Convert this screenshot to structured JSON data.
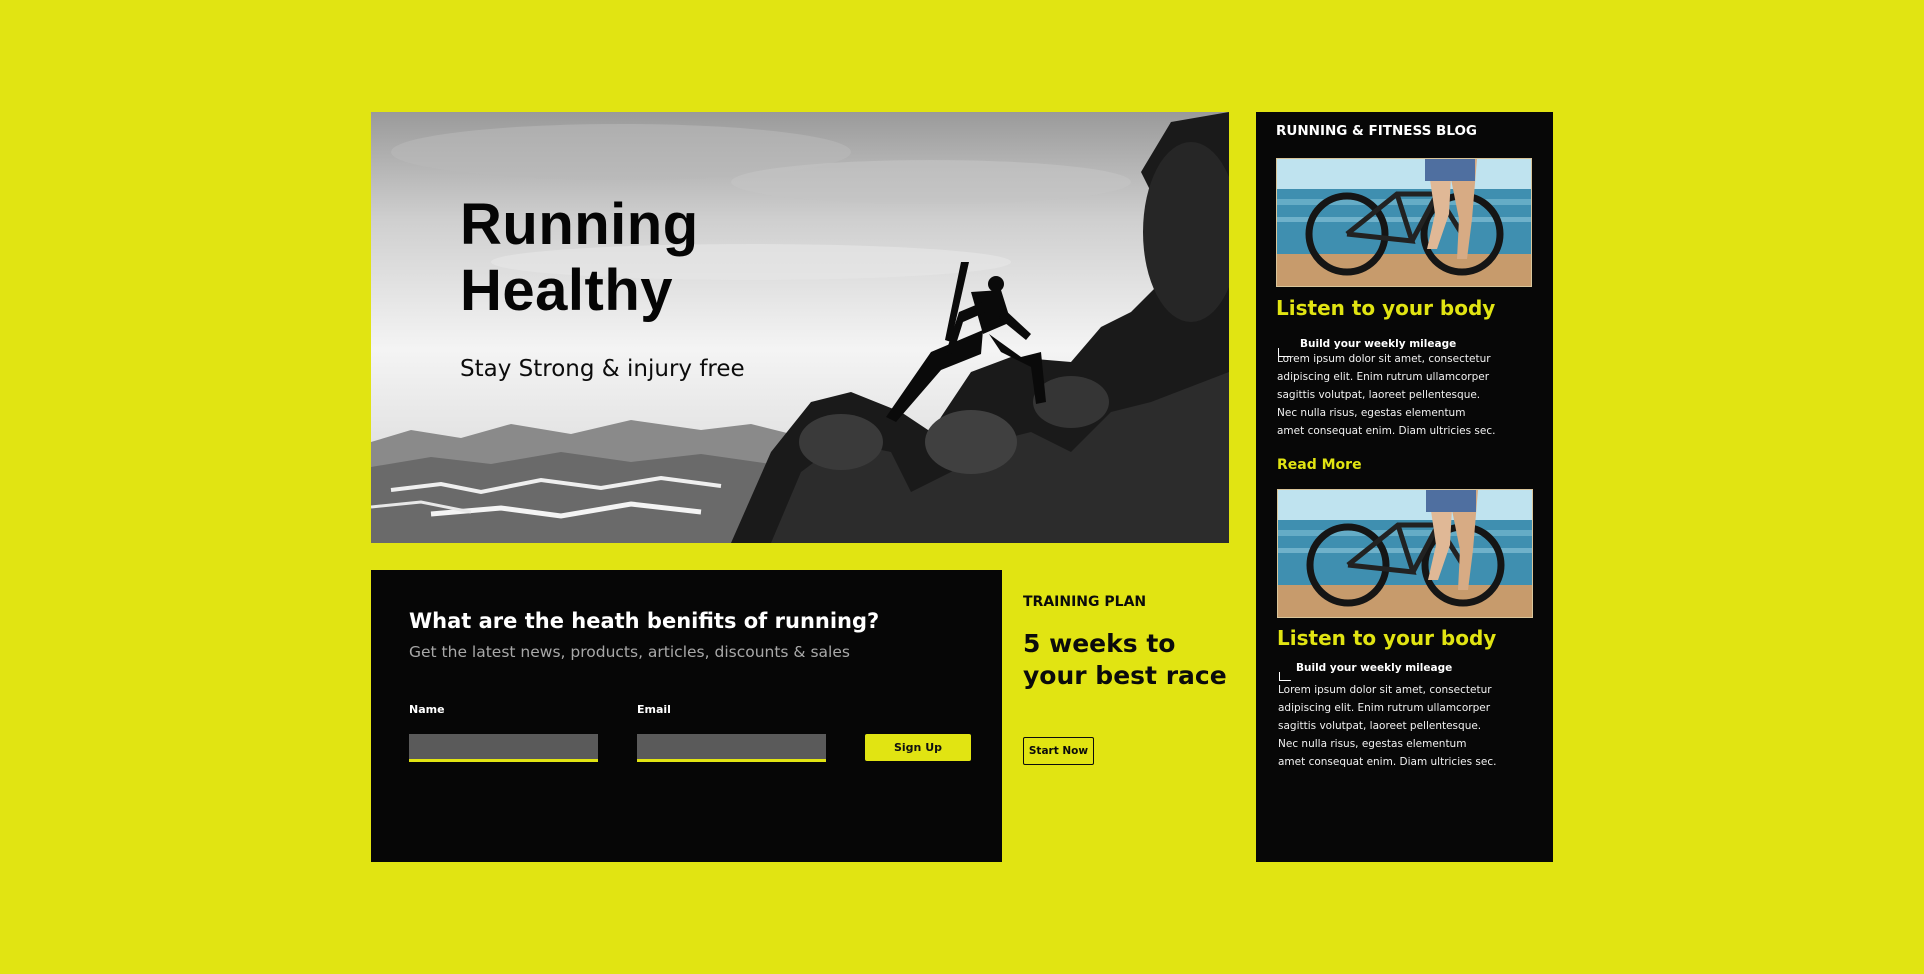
{
  "hero": {
    "title_line1": "Running",
    "title_line2": "Healthy",
    "subtitle": "Stay Strong & injury free"
  },
  "newsletter": {
    "title": "What are the heath benifits of running?",
    "subtitle": "Get the latest news, products, articles, discounts & sales",
    "name_label": "Name",
    "name_value": "",
    "email_label": "Email",
    "email_value": "",
    "signup_label": "Sign Up"
  },
  "training_plan": {
    "kicker": "TRAINING PLAN",
    "title": "5 weeks to your best race",
    "button_label": "Start Now"
  },
  "blog": {
    "heading": "RUNNING & FITNESS BLOG",
    "posts": [
      {
        "title": "Listen to your body",
        "subtitle": "Build your weekly mileage",
        "body": [
          "Lorem ipsum dolor sit amet, consectetur",
          "adipiscing elit. Enim rutrum ullamcorper",
          " sagittis volutpat, laoreet pellentesque.",
          "Nec nulla risus, egestas elementum",
          " amet consequat enim. Diam ultricies sec."
        ],
        "read_more": "Read More"
      },
      {
        "title": "Listen to your body",
        "subtitle": "Build your weekly mileage",
        "body": [
          "Lorem ipsum dolor sit amet, consectetur",
          "adipiscing elit. Enim rutrum ullamcorper",
          " sagittis volutpat, laoreet pellentesque.",
          "Nec nulla risus, egestas elementum",
          " amet consequat enim. Diam ultricies sec."
        ]
      }
    ]
  },
  "colors": {
    "accent": "#e1e412",
    "panel": "#060606",
    "input_bg": "#5a5a5a"
  }
}
